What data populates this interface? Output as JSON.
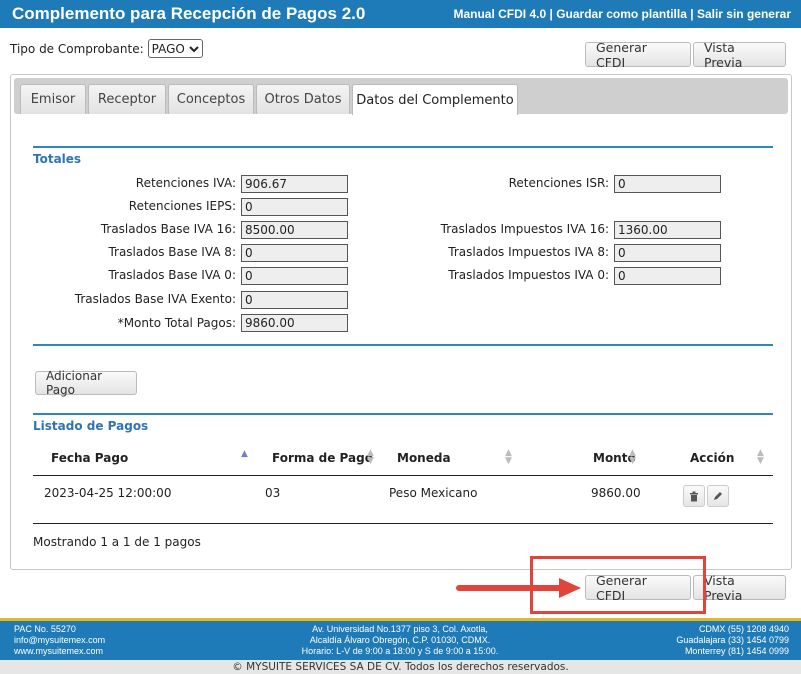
{
  "header": {
    "title": "Complemento para Recepción de Pagos  2.0",
    "links": [
      "Manual CFDI 4.0",
      "Guardar como plantilla",
      "Salir sin generar"
    ],
    "separator": "|"
  },
  "tipo": {
    "label": "Tipo de Comprobante:",
    "value": "PAGO"
  },
  "actions": {
    "generar": "Generar CFDI",
    "vista_previa": "Vista Previa"
  },
  "tabs": [
    "Emisor",
    "Receptor",
    "Conceptos",
    "Otros Datos",
    "Datos del Complemento"
  ],
  "totales": {
    "title": "Totales",
    "left": [
      {
        "label": "Retenciones IVA:",
        "value": "906.67"
      },
      {
        "label": "Retenciones IEPS:",
        "value": "0"
      },
      {
        "label": "Traslados Base IVA 16:",
        "value": "8500.00"
      },
      {
        "label": "Traslados Base IVA 8:",
        "value": "0"
      },
      {
        "label": "Traslados Base IVA 0:",
        "value": "0"
      },
      {
        "label": "Traslados Base IVA Exento:",
        "value": "0"
      },
      {
        "label": "*Monto Total Pagos:",
        "value": "9860.00"
      }
    ],
    "right": [
      {
        "label": "Retenciones ISR:",
        "value": "0"
      },
      {
        "label": "Traslados Impuestos IVA 16:",
        "value": "1360.00"
      },
      {
        "label": "Traslados Impuestos IVA 8:",
        "value": "0"
      },
      {
        "label": "Traslados Impuestos IVA 0:",
        "value": "0"
      }
    ]
  },
  "adicionar_pago": "Adicionar Pago",
  "listado": {
    "title": "Listado de Pagos",
    "columns": [
      "Fecha Pago",
      "Forma de Pago",
      "Moneda",
      "Monto",
      "Acción"
    ],
    "rows": [
      {
        "fecha": "2023-04-25 12:00:00",
        "forma": "03",
        "moneda": "Peso Mexicano",
        "monto": "9860.00"
      }
    ],
    "summary": "Mostrando 1 a 1 de 1 pagos"
  },
  "footer": {
    "left": [
      "PAC No. 55270",
      "info@mysuitemex.com",
      "www.mysuitemex.com"
    ],
    "center": [
      "Av. Universidad No.1377 piso 3, Col. Axotla,",
      "Alcaldía Álvaro Obregón, C.P. 01030, CDMX.",
      "Horario: L-V de 9:00 a 18:00 y S de 9:00 a 15:00."
    ],
    "right": [
      "CDMX (55) 1208 4940",
      "Guadalajara (33) 1454 0799",
      "Monterrey (81) 1454 0999"
    ],
    "copyright": "© MYSUITE SERVICES SA DE CV. Todos los derechos reservados."
  },
  "colors": {
    "brand_blue": "#1e7bb8",
    "section_blue": "#2e75b6",
    "highlight_red": "#e0443a",
    "footer_accent": "#e8b820"
  }
}
